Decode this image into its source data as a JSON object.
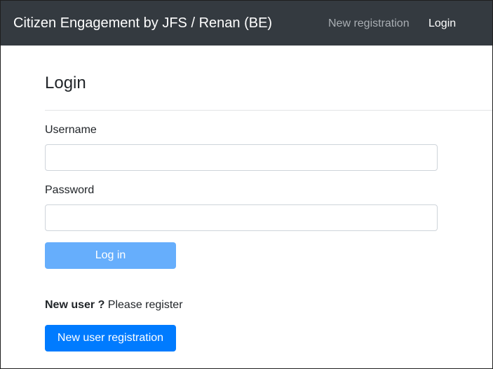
{
  "navbar": {
    "brand": "Citizen Engagement by JFS / Renan (BE)",
    "links": [
      {
        "label": "New registration"
      },
      {
        "label": "Login"
      }
    ]
  },
  "login": {
    "title": "Login",
    "username_label": "Username",
    "username_value": "",
    "password_label": "Password",
    "password_value": "",
    "submit_label": "Log in"
  },
  "register": {
    "prompt_bold": "New user ?",
    "prompt_text": " Please register",
    "button_label": "New user registration"
  },
  "colors": {
    "navbar_bg": "#343a40",
    "primary": "#007bff",
    "primary_disabled": "#66aefc"
  }
}
